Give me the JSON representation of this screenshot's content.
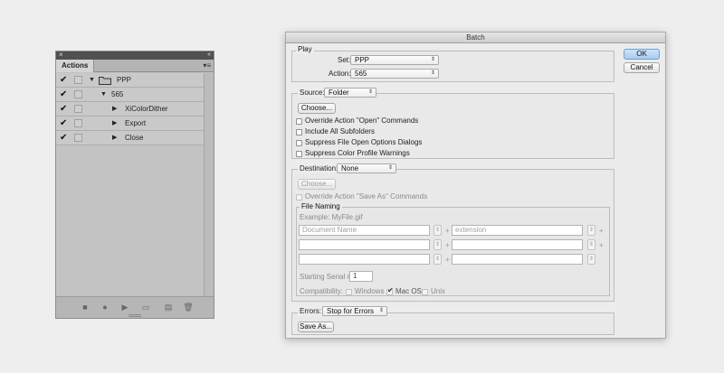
{
  "actions_panel": {
    "close_glyph": "×",
    "collapse_glyph": "«",
    "tab_label": "Actions",
    "menu_glyph": "▾≡",
    "rows": [
      {
        "check": "✔",
        "expander": "▼",
        "label": "PPP",
        "level": 0,
        "is_set": true
      },
      {
        "check": "✔",
        "expander": "▼",
        "label": "565",
        "level": 1,
        "is_set": false
      },
      {
        "check": "✔",
        "expander": "▶",
        "label": "XiColorDither",
        "level": 2,
        "is_set": false
      },
      {
        "check": "✔",
        "expander": "▶",
        "label": "Export",
        "level": 2,
        "is_set": false
      },
      {
        "check": "✔",
        "expander": "▶",
        "label": "Close",
        "level": 2,
        "is_set": false
      }
    ],
    "tools": [
      {
        "name": "stop-icon",
        "glyph": "■"
      },
      {
        "name": "record-icon",
        "glyph": "●"
      },
      {
        "name": "play-icon",
        "glyph": "▶"
      },
      {
        "name": "new-set-icon",
        "glyph": "▭"
      },
      {
        "name": "new-action-icon",
        "glyph": "▤"
      },
      {
        "name": "trash-icon",
        "glyph": "🗑"
      }
    ]
  },
  "dialog": {
    "title": "Batch",
    "ok_label": "OK",
    "cancel_label": "Cancel",
    "play": {
      "title": "Play",
      "set_label": "Set:",
      "set_value": "PPP",
      "action_label": "Action:",
      "action_value": "565"
    },
    "source": {
      "label": "Source:",
      "value": "Folder",
      "choose_label": "Choose...",
      "checkboxes": [
        "Override Action \"Open\" Commands",
        "Include All Subfolders",
        "Suppress File Open Options Dialogs",
        "Suppress Color Profile Warnings"
      ]
    },
    "destination": {
      "label": "Destination:",
      "value": "None",
      "choose_label": "Choose...",
      "override_label": "Override Action \"Save As\" Commands"
    },
    "file_naming": {
      "title": "File Naming",
      "example": "Example: MyFile.gif",
      "fields": [
        [
          "Document Name",
          "extension"
        ],
        [
          "",
          ""
        ],
        [
          "",
          ""
        ]
      ],
      "stepper_glyph": "⇕",
      "plus_glyph": "+",
      "serial_label": "Starting Serial #:",
      "serial_value": "1",
      "compat_label": "Compatibility:",
      "compat_windows": "Windows",
      "compat_macos": "Mac OS",
      "compat_unix": "Unix",
      "check_glyph": "✔"
    },
    "errors": {
      "label": "Errors:",
      "value": "Stop for Errors",
      "save_as_label": "Save As..."
    },
    "select_arrows": "⇕"
  }
}
